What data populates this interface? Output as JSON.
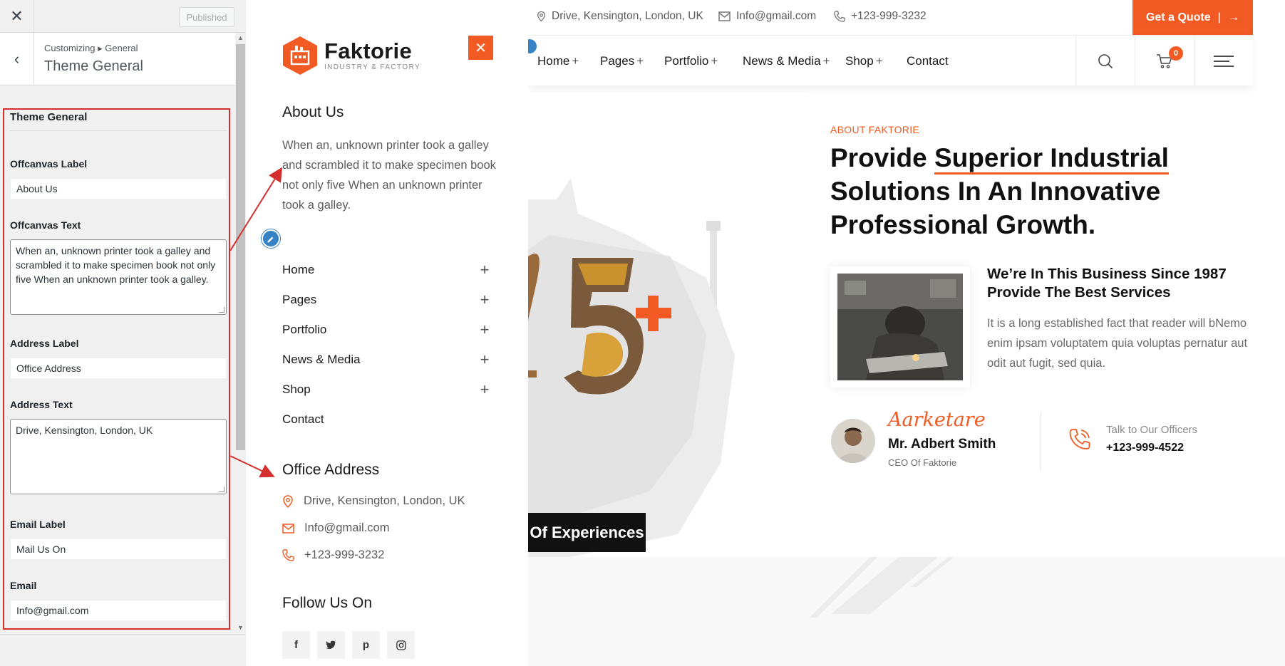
{
  "customizer": {
    "close_icon": "close-icon",
    "publish_label": "Published",
    "breadcrumb": "Customizing ▸ General",
    "title": "Theme General",
    "section_title": "Theme General",
    "fields": {
      "offcanvas_label": {
        "label": "Offcanvas Label",
        "value": "About Us"
      },
      "offcanvas_text": {
        "label": "Offcanvas Text",
        "value": "When an, unknown printer took a galley and scrambled it to make specimen book not only five When an unknown printer took a galley."
      },
      "address_label": {
        "label": "Address Label",
        "value": "Office Address"
      },
      "address_text": {
        "label": "Address Text",
        "value": "Drive, Kensington, London, UK"
      },
      "email_label": {
        "label": "Email Label",
        "value": "Mail Us On"
      },
      "email": {
        "label": "Email",
        "value": "Info@gmail.com"
      }
    }
  },
  "offcanvas": {
    "logo_title": "Faktorie",
    "logo_subtitle": "INDUSTRY & FACTORY",
    "about_heading": "About Us",
    "about_text": "When an, unknown printer took a galley and scrambled it to make specimen book not only five When an unknown printer took a galley.",
    "menu": [
      {
        "label": "Home",
        "plus": "+"
      },
      {
        "label": "Pages",
        "plus": "+"
      },
      {
        "label": "Portfolio",
        "plus": "+"
      },
      {
        "label": "News & Media",
        "plus": "+"
      },
      {
        "label": "Shop",
        "plus": "+"
      },
      {
        "label": "Contact",
        "plus": ""
      }
    ],
    "office_heading": "Office Address",
    "address": "Drive, Kensington, London, UK",
    "email": "Info@gmail.com",
    "phone": "+123-999-3232",
    "follow_heading": "Follow Us On",
    "social": [
      "f",
      "t",
      "p",
      "i"
    ]
  },
  "site": {
    "topbar": {
      "address": "Drive, Kensington, London, UK",
      "email": "Info@gmail.com",
      "phone": "+123-999-3232",
      "quote": "Get a Quote"
    },
    "nav": [
      {
        "label": "Home",
        "plus": "+"
      },
      {
        "label": "Pages",
        "plus": "+"
      },
      {
        "label": "Portfolio",
        "plus": "+"
      },
      {
        "label": "News & Media",
        "plus": "+"
      },
      {
        "label": "Shop",
        "plus": "+"
      },
      {
        "label": "Contact",
        "plus": ""
      }
    ],
    "cart_count": "0",
    "hero_number_plus": "+",
    "experience_badge": "Of Experiences",
    "eyebrow": "ABOUT FAKTORIE",
    "headline_1": "Provide ",
    "headline_u": "Superior Industrial",
    "headline_2": "Solutions In An Innovative Professional Growth.",
    "since_title": "We’re In This Business Since 1987 Provide The Best Services",
    "since_text": "It is a long established fact that reader will bNemo enim ipsam voluptatem quia voluptas pernatur aut odit aut fugit, sed quia.",
    "signature": "Aarketare",
    "ceo_name": "Mr. Adbert Smith",
    "ceo_role": "CEO Of Faktorie",
    "talk_label": "Talk to Our Officers",
    "talk_phone": "+123-999-4522"
  },
  "colors": {
    "accent": "#f15a22",
    "annotation": "#d32f2f",
    "customizer_bg": "#f0f0f1"
  }
}
